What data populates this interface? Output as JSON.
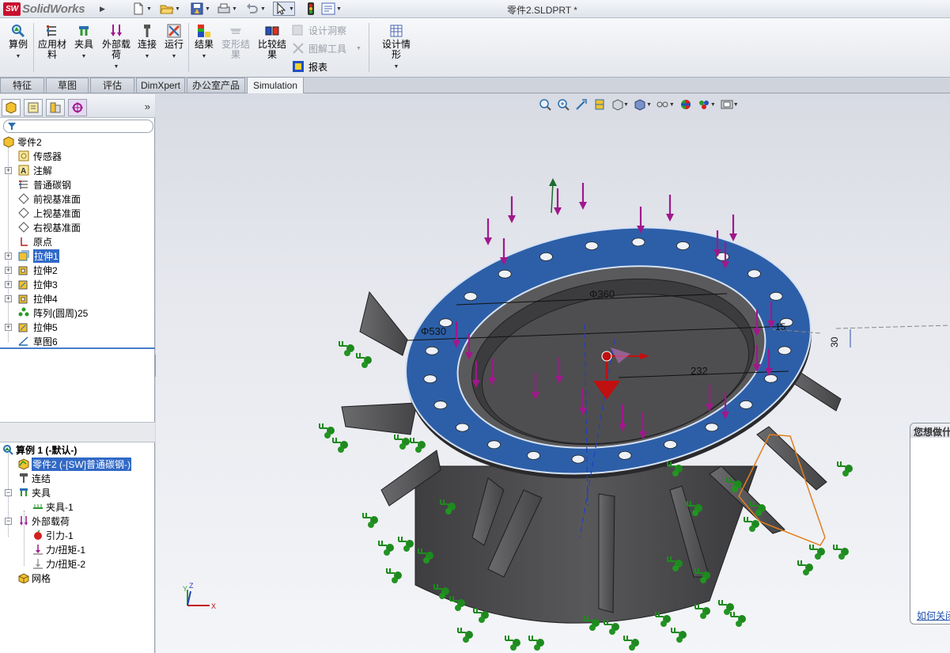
{
  "app": {
    "brand": "SolidWorks",
    "brand_badge": "SW",
    "document_title": "零件2.SLDPRT *"
  },
  "ribbon": {
    "study": "算例",
    "apply_material": "应用材料",
    "fixtures": "夹具",
    "external_loads": "外部载荷",
    "connections": "连接",
    "run": "运行",
    "results": "结果",
    "deformed_result": "变形结果",
    "compare_results": "比较结果",
    "design_insight": "设计洞察",
    "plot_tools": "图解工具",
    "report": "报表",
    "design_scenario": "设计情形"
  },
  "tabs": [
    "特征",
    "草图",
    "评估",
    "DimXpert",
    "办公室产品",
    "Simulation"
  ],
  "feature_tree": {
    "root": "零件2",
    "items": [
      "传感器",
      "注解",
      "普通碳钢",
      "前视基准面",
      "上视基准面",
      "右视基准面",
      "原点",
      "拉伸1",
      "拉伸2",
      "拉伸3",
      "拉伸4",
      "阵列(圆周)25",
      "拉伸5",
      "草图6"
    ]
  },
  "sim_tree": {
    "study": "算例 1 (-默认-)",
    "part": "零件2 (-[SW]普通碳钢-)",
    "connections": "连结",
    "fixtures": "夹具",
    "fixture1": "夹具-1",
    "external_loads": "外部载荷",
    "gravity": "引力-1",
    "force1": "力/扭矩-1",
    "force2": "力/扭矩-2",
    "mesh": "网格"
  },
  "dimensions": {
    "d360": "Φ360",
    "d530": "Φ530",
    "d232": "232",
    "d30": "30",
    "d15": "15"
  },
  "triad": {
    "x": "X",
    "y": "Y",
    "z": "Z"
  },
  "task_pane": {
    "title": "您想做什么",
    "link": "如何关闭"
  },
  "colors": {
    "flange_blue": "#2d5fa8",
    "body_grey": "#4a4a4c",
    "load_magenta": "#a0188c",
    "fixture_green": "#1e8a1e",
    "selection_blue": "#3169c6"
  },
  "icons": [
    "new-file-icon",
    "open-folder-icon",
    "save-icon",
    "print-icon",
    "undo-icon",
    "select-arrow-icon",
    "rebuild-traffic-light-icon",
    "options-icon"
  ]
}
